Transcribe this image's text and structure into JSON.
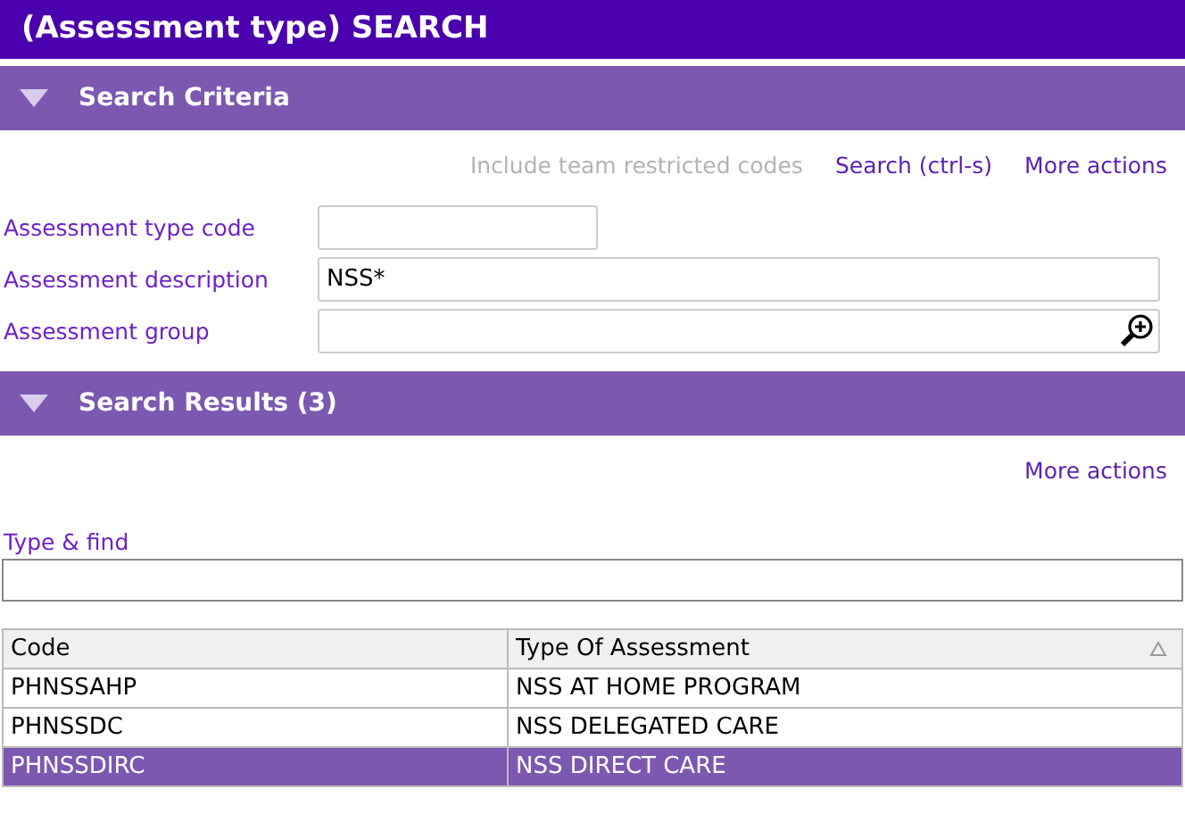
{
  "window": {
    "title": "(Assessment type) SEARCH"
  },
  "criteria": {
    "title": "Search Criteria",
    "expanded": true,
    "actions": [
      {
        "label": "Include team restricted codes",
        "disabled": true
      },
      {
        "label": "Search (ctrl-s)",
        "disabled": false
      },
      {
        "label": "More actions",
        "disabled": false
      }
    ],
    "fields": [
      {
        "kind": "short",
        "label": "Assessment type code"
      },
      {
        "kind": "text",
        "label": "Assessment description",
        "value": "NSS*"
      },
      {
        "kind": "lookup",
        "label": "Assessment group"
      }
    ]
  },
  "results": {
    "title": "Search Results (3)",
    "expanded": true,
    "actions": [
      {
        "label": "More actions",
        "disabled": false
      }
    ],
    "find": {
      "label": "Type & find"
    },
    "table": {
      "columns": [
        {
          "label": "Code",
          "sorted": false
        },
        {
          "label": "Type Of Assessment",
          "sorted": true
        }
      ],
      "rows": [
        {
          "cells": [
            "PHNSSAHP",
            "NSS AT HOME PROGRAM"
          ],
          "selected": false
        },
        {
          "cells": [
            "PHNSSDC",
            "NSS DELEGATED CARE"
          ],
          "selected": false
        },
        {
          "cells": [
            "PHNSSDIRC",
            "NSS DIRECT CARE"
          ],
          "selected": true
        }
      ]
    }
  }
}
